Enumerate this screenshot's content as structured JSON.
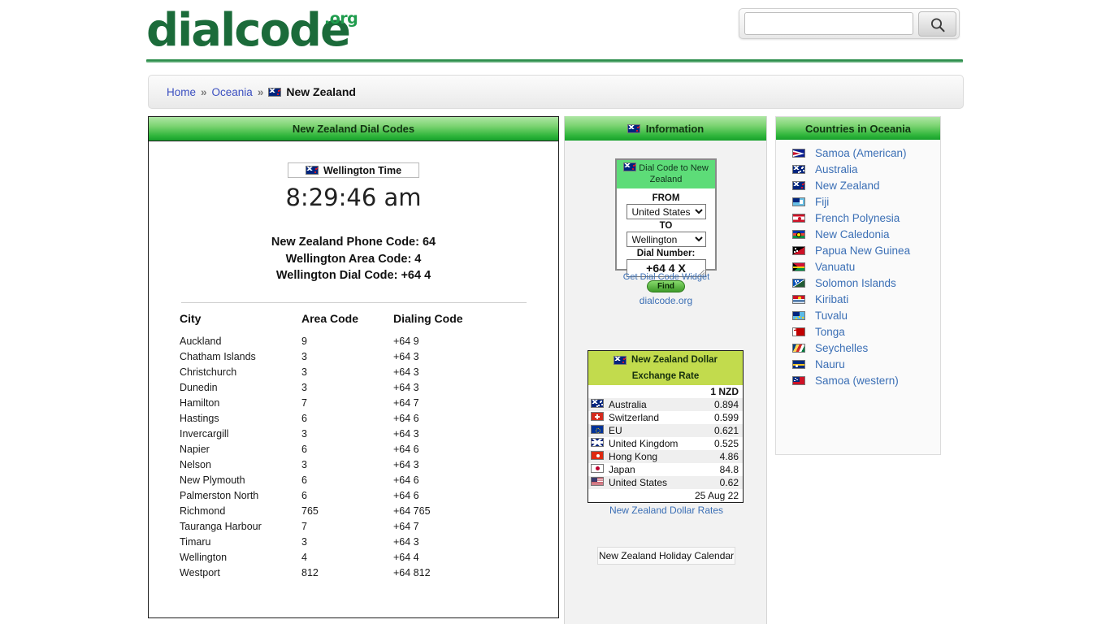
{
  "site": {
    "logo_text": "dialcode",
    "logo_suffix": ".org",
    "accent_green": "#1b6b3a"
  },
  "search": {
    "value": "",
    "placeholder": "",
    "icon": "search-icon"
  },
  "breadcrumb": {
    "home": "Home",
    "sep1": "»",
    "region": "Oceania",
    "sep2": "»",
    "current": "New Zealand",
    "flag": "nz"
  },
  "main": {
    "header": "New Zealand Dial Codes",
    "clock_label": "Wellington Time",
    "clock_flag": "nz",
    "time": "8:29:46 am",
    "code_lines": [
      "New Zealand Phone Code: 64",
      "Wellington Area Code: 4",
      "Wellington Dial Code: +64 4"
    ],
    "table": {
      "columns": [
        "City",
        "Area Code",
        "Dialing Code"
      ],
      "rows": [
        [
          "Auckland",
          "9",
          "+64 9"
        ],
        [
          "Chatham Islands",
          "3",
          "+64 3"
        ],
        [
          "Christchurch",
          "3",
          "+64 3"
        ],
        [
          "Dunedin",
          "3",
          "+64 3"
        ],
        [
          "Hamilton",
          "7",
          "+64 7"
        ],
        [
          "Hastings",
          "6",
          "+64 6"
        ],
        [
          "Invercargill",
          "3",
          "+64 3"
        ],
        [
          "Napier",
          "6",
          "+64 6"
        ],
        [
          "Nelson",
          "3",
          "+64 3"
        ],
        [
          "New Plymouth",
          "6",
          "+64 6"
        ],
        [
          "Palmerston North",
          "6",
          "+64 6"
        ],
        [
          "Richmond",
          "765",
          "+64 765"
        ],
        [
          "Tauranga Harbour",
          "7",
          "+64 7"
        ],
        [
          "Timaru",
          "3",
          "+64 3"
        ],
        [
          "Wellington",
          "4",
          "+64 4"
        ],
        [
          "Westport",
          "812",
          "+64 812"
        ]
      ]
    }
  },
  "info": {
    "header": "Information",
    "header_flag": "nz",
    "widget": {
      "title": "Dial Code to New Zealand",
      "title_flag": "nz",
      "from_label": "FROM",
      "from_value": "United States",
      "to_label": "TO",
      "to_value": "Wellington",
      "dial_label": "Dial Number:",
      "dial_value": "+64 4 X",
      "find_label": "Find",
      "site_link": "dialcode.org",
      "widget_link": "Get Dial Code Widget"
    },
    "fx": {
      "title_line1": "New Zealand Dollar",
      "title_line2": "Exchange Rate",
      "title_flag": "nz",
      "unit": "1 NZD",
      "rows": [
        {
          "flag": "au",
          "name": "Australia",
          "value": "0.894"
        },
        {
          "flag": "ch",
          "name": "Switzerland",
          "value": "0.599"
        },
        {
          "flag": "eu",
          "name": "EU",
          "value": "0.621"
        },
        {
          "flag": "uk",
          "name": "United Kingdom",
          "value": "0.525"
        },
        {
          "flag": "hk",
          "name": "Hong Kong",
          "value": "4.86"
        },
        {
          "flag": "jp",
          "name": "Japan",
          "value": "84.8"
        },
        {
          "flag": "us",
          "name": "United States",
          "value": "0.62"
        }
      ],
      "date": "25 Aug 22",
      "rates_link": "New Zealand Dollar Rates"
    },
    "holiday_button": "New Zealand Holiday Calendar"
  },
  "countries": {
    "header": "Countries in Oceania",
    "items": [
      {
        "flag": "as",
        "label": "Samoa (American)"
      },
      {
        "flag": "au",
        "label": "Australia"
      },
      {
        "flag": "nz",
        "label": "New Zealand"
      },
      {
        "flag": "fj",
        "label": "Fiji"
      },
      {
        "flag": "pf",
        "label": "French Polynesia"
      },
      {
        "flag": "nc",
        "label": "New Caledonia"
      },
      {
        "flag": "pg",
        "label": "Papua New Guinea"
      },
      {
        "flag": "vu",
        "label": "Vanuatu"
      },
      {
        "flag": "sb",
        "label": "Solomon Islands"
      },
      {
        "flag": "ki",
        "label": "Kiribati"
      },
      {
        "flag": "tv",
        "label": "Tuvalu"
      },
      {
        "flag": "to",
        "label": "Tonga"
      },
      {
        "flag": "sc",
        "label": "Seychelles"
      },
      {
        "flag": "nr",
        "label": "Nauru"
      },
      {
        "flag": "ws",
        "label": "Samoa (western)"
      }
    ]
  }
}
